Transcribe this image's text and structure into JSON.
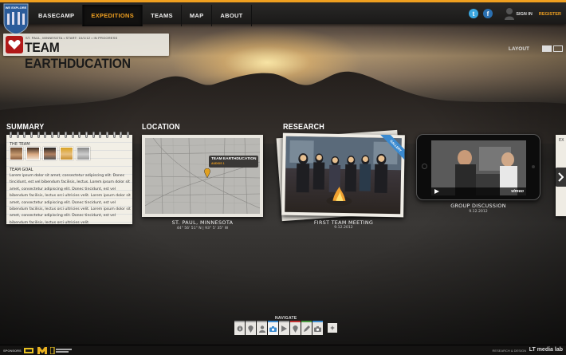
{
  "brand": {
    "logo_text": "WE EXPLORE"
  },
  "nav": {
    "items": [
      {
        "label": "BASECAMP",
        "active": false
      },
      {
        "label": "EXPEDITIONS",
        "active": true
      },
      {
        "label": "TEAMS",
        "active": false
      },
      {
        "label": "MAP",
        "active": false
      },
      {
        "label": "ABOUT",
        "active": false
      }
    ],
    "social": {
      "twitter": "t",
      "facebook": "f"
    },
    "sign_in": "SIGN IN",
    "register": "REGISTER"
  },
  "team": {
    "meta": "ST. PAUL, MINNESOTA  •  START: 10/1/12  •  IN PROGRESS",
    "title": "TEAM EARTHDUCATION"
  },
  "layout": {
    "label": "LAYOUT"
  },
  "sections": {
    "summary": "SUMMARY",
    "location": "LOCATION",
    "research": "RESEARCH"
  },
  "summary": {
    "team_label": "THE TEAM",
    "goal_label": "TEAM GOAL",
    "goal_text": "Lorem ipsum dolor sit amet, consectetur adipiscing elit. Donec tincidunt, est vel bibendum facilisis, lectus. Lorem ipsum dolor sit amet, consectetur adipiscing elit. Donec tincidunt, est vel bibendum facilisis, lectus orci ultricies velit. Lorem ipsum dolor sit amet, consectetur adipiscing elit. Donec tincidunt, est vel bibendum facilisis, lectus orci ultricies velit. Lorem ipsum dolor sit amet, consectetur adipiscing elit. Donec tincidunt, est vel bibendum facilisis, lectus orci ultricies velit."
  },
  "location": {
    "map_label": "TEAM EARTHDUCATION",
    "map_sublabel": "AUDIOS 1",
    "caption": "ST. PAUL, MINNESOTA",
    "coords": "44° 56' 51\" N | 93° 5' 35\" W"
  },
  "research": {
    "photo_badge": "GALLERY",
    "photo_caption": "FIRST TEAM MEETING",
    "photo_date": "9.12.2012",
    "video_caption": "GROUP DISCUSSION",
    "video_date": "9.12.2012",
    "video_brand": "vimeo"
  },
  "peek": {
    "text": "EX"
  },
  "navigate": {
    "label": "NAVIGATE",
    "tools": [
      "info-icon",
      "pin-icon",
      "person-icon",
      "camera-icon",
      "play-icon",
      "pin-icon",
      "pencil-icon",
      "camera-icon"
    ],
    "add": "+"
  },
  "footer": {
    "sponsors_label": "SPONSORS",
    "research_design": "RESEARCH & DESIGN",
    "medialab": "LT media lab"
  },
  "colors": {
    "accent": "#f0a020",
    "brand_red": "#b01818",
    "link_blue": "#3a8ad0"
  }
}
